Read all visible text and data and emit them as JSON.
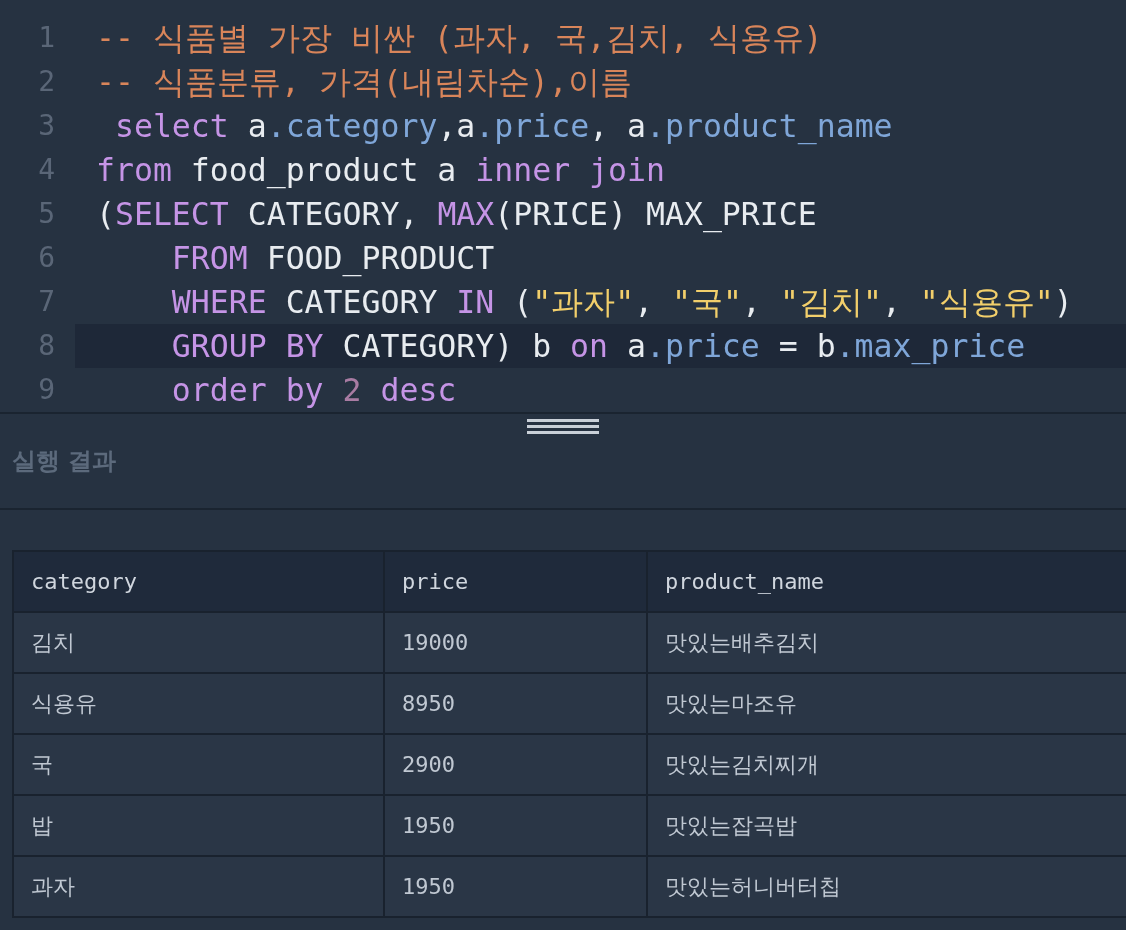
{
  "editor": {
    "lines": [
      {
        "number": "1",
        "highlighted": false,
        "tokens": [
          {
            "text": "-- 식품별 가장 비싼 (과자, 국,김치, 식용유)",
            "kind": "comment"
          }
        ]
      },
      {
        "number": "2",
        "highlighted": false,
        "tokens": [
          {
            "text": "-- 식품분류, 가격(내림차순),이름",
            "kind": "comment"
          }
        ]
      },
      {
        "number": "3",
        "highlighted": false,
        "tokens": [
          {
            "text": " select",
            "kind": "keyword"
          },
          {
            "text": " a",
            "kind": "plain"
          },
          {
            "text": ".category",
            "kind": "property"
          },
          {
            "text": ",a",
            "kind": "plain"
          },
          {
            "text": ".price",
            "kind": "property"
          },
          {
            "text": ", a",
            "kind": "plain"
          },
          {
            "text": ".product_name",
            "kind": "property"
          }
        ]
      },
      {
        "number": "4",
        "highlighted": false,
        "tokens": [
          {
            "text": "from",
            "kind": "keyword"
          },
          {
            "text": " food_product a ",
            "kind": "plain"
          },
          {
            "text": "inner join",
            "kind": "keyword"
          }
        ]
      },
      {
        "number": "5",
        "highlighted": false,
        "tokens": [
          {
            "text": "(",
            "kind": "plain"
          },
          {
            "text": "SELECT",
            "kind": "keyword"
          },
          {
            "text": " CATEGORY, ",
            "kind": "plain"
          },
          {
            "text": "MAX",
            "kind": "keyword"
          },
          {
            "text": "(PRICE) MAX_PRICE",
            "kind": "plain"
          }
        ]
      },
      {
        "number": "6",
        "highlighted": false,
        "indented": true,
        "tokens": [
          {
            "text": "FROM",
            "kind": "keyword"
          },
          {
            "text": " FOOD_PRODUCT",
            "kind": "plain"
          }
        ]
      },
      {
        "number": "7",
        "highlighted": false,
        "indented": true,
        "tokens": [
          {
            "text": "WHERE",
            "kind": "keyword"
          },
          {
            "text": " CATEGORY ",
            "kind": "plain"
          },
          {
            "text": "IN",
            "kind": "keyword"
          },
          {
            "text": " (",
            "kind": "plain"
          },
          {
            "text": "\"과자\"",
            "kind": "string"
          },
          {
            "text": ", ",
            "kind": "plain"
          },
          {
            "text": "\"국\"",
            "kind": "string"
          },
          {
            "text": ", ",
            "kind": "plain"
          },
          {
            "text": "\"김치\"",
            "kind": "string"
          },
          {
            "text": ", ",
            "kind": "plain"
          },
          {
            "text": "\"식용유\"",
            "kind": "string"
          },
          {
            "text": ")",
            "kind": "plain"
          }
        ]
      },
      {
        "number": "8",
        "highlighted": true,
        "indented": true,
        "tokens": [
          {
            "text": "GROUP BY",
            "kind": "keyword"
          },
          {
            "text": " CATEGORY) b ",
            "kind": "plain"
          },
          {
            "text": "on",
            "kind": "keyword"
          },
          {
            "text": " a",
            "kind": "plain"
          },
          {
            "text": ".price",
            "kind": "property"
          },
          {
            "text": " = b",
            "kind": "plain"
          },
          {
            "text": ".max_price",
            "kind": "property"
          }
        ]
      },
      {
        "number": "9",
        "highlighted": false,
        "indented": true,
        "tokens": [
          {
            "text": "order by",
            "kind": "keyword"
          },
          {
            "text": " 2",
            "kind": "number"
          },
          {
            "text": " desc",
            "kind": "keyword"
          }
        ]
      }
    ]
  },
  "results": {
    "title": "실행 결과",
    "columns": [
      "category",
      "price",
      "product_name"
    ],
    "rows": [
      [
        "김치",
        "19000",
        "맛있는배추김치"
      ],
      [
        "식용유",
        "8950",
        "맛있는마조유"
      ],
      [
        "국",
        "2900",
        "맛있는김치찌개"
      ],
      [
        "밥",
        "1950",
        "맛있는잡곡밥"
      ],
      [
        "과자",
        "1950",
        "맛있는허니버터칩"
      ]
    ]
  }
}
